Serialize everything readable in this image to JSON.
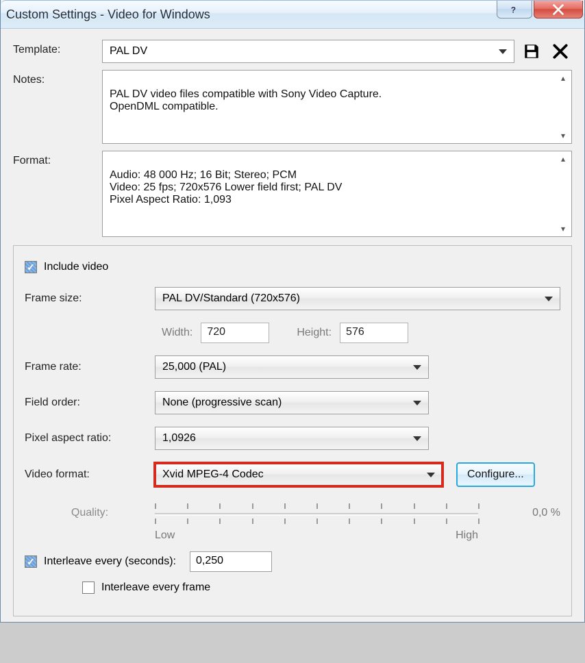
{
  "window": {
    "title": "Custom Settings - Video for Windows"
  },
  "template": {
    "label": "Template:",
    "value": "PAL DV"
  },
  "notes": {
    "label": "Notes:",
    "text": "PAL DV video files compatible with Sony Video Capture.\nOpenDML compatible."
  },
  "format": {
    "label": "Format:",
    "text": "Audio: 48 000 Hz; 16 Bit; Stereo; PCM\nVideo: 25 fps; 720x576 Lower field first; PAL DV\nPixel Aspect Ratio: 1,093"
  },
  "video_group": {
    "include_video": "Include video",
    "frame_size": {
      "label": "Frame size:",
      "value": "PAL DV/Standard (720x576)"
    },
    "dims": {
      "width_label": "Width:",
      "width_value": "720",
      "height_label": "Height:",
      "height_value": "576"
    },
    "frame_rate": {
      "label": "Frame rate:",
      "value": "25,000 (PAL)"
    },
    "field_order": {
      "label": "Field order:",
      "value": "None (progressive scan)"
    },
    "pixel_aspect": {
      "label": "Pixel aspect ratio:",
      "value": "1,0926"
    },
    "video_format": {
      "label": "Video format:",
      "value": "Xvid MPEG-4 Codec",
      "configure": "Configure..."
    },
    "quality": {
      "label": "Quality:",
      "low": "Low",
      "high": "High",
      "percent": "0,0 %"
    },
    "interleave": {
      "label": "Interleave every (seconds):",
      "value": "0,250",
      "frame_label": "Interleave every frame"
    }
  }
}
